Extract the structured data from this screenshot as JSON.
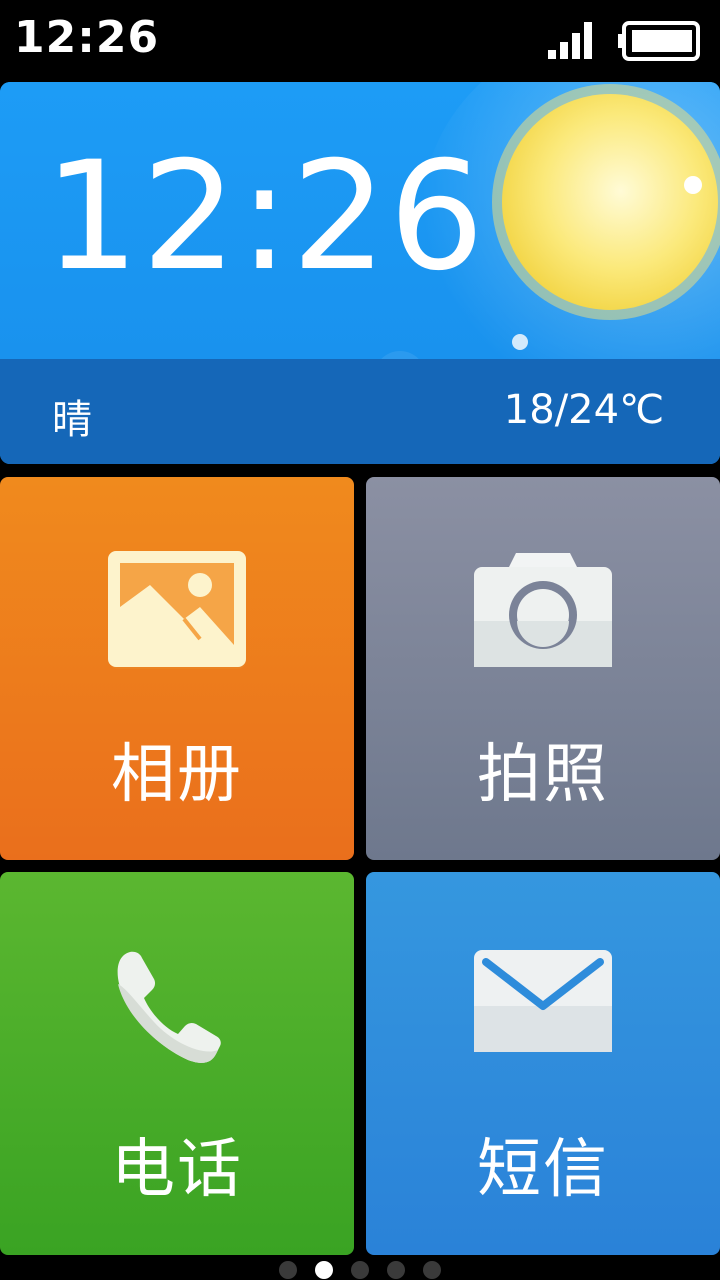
{
  "status_bar": {
    "time": "12:26",
    "signal_icon": "signal-bars-icon",
    "battery_icon": "battery-icon"
  },
  "weather_widget": {
    "clock": "12:26",
    "condition": "晴",
    "temperature": "18/24℃",
    "art_icon": "sun-icon"
  },
  "tiles": [
    {
      "label": "相册",
      "icon": "gallery-icon",
      "color": "#ee7a1d"
    },
    {
      "label": "拍照",
      "icon": "camera-icon",
      "color": "#7b8398"
    },
    {
      "label": "电话",
      "icon": "phone-icon",
      "color": "#4aad29"
    },
    {
      "label": "短信",
      "icon": "message-icon",
      "color": "#2e8cdb"
    }
  ],
  "page_indicator": {
    "pages": 5,
    "active_index": 1
  }
}
